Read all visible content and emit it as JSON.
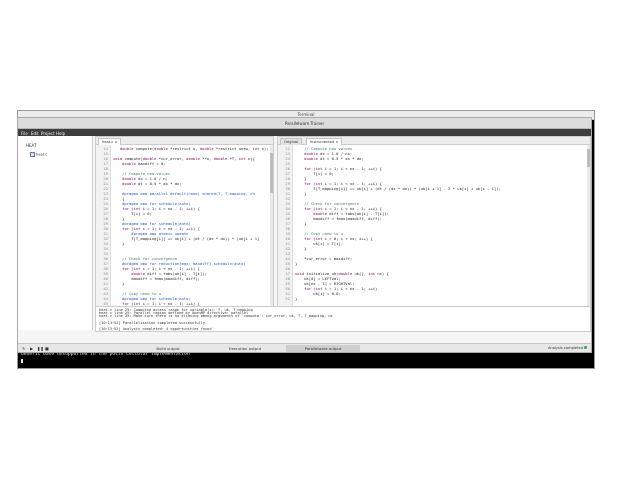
{
  "terminal": {
    "title": "Terminal",
    "line": "Generic base unsupported in the posix cellular implementation"
  },
  "ide": {
    "title": "Parallelware Trainer",
    "menu": [
      "File",
      "Edit",
      "Project",
      "Help"
    ]
  },
  "tree": {
    "root": "HEAT",
    "file": "heat.c"
  },
  "left_editor": {
    "tab": "heat.c",
    "first_line": 14,
    "lines": [
      "   double compute(double *restrict u, double *restrict unew, int n);",
      "",
      "void compute(double *cur_error, double **u, double *T, int n){",
      "    double maxdiff = 0;",
      "",
      "    // Compute new values",
      "    double dx = 1.0 / n;",
      "    double dt = 0.5 * dx * dx;",
      "",
      "    #pragma omp parallel default(none) shared(T, T_mapping, ch",
      "    {",
      "    #pragma omp for schedule(auto)",
      "    for (int i = 1; i < nx - 1; ++i) {",
      "        T[i] = 0;",
      "    }",
      "    #pragma omp for schedule(auto)",
      "    for (int i = 1; i < nx - 1; ++i) {",
      "        #pragma omp atomic update",
      "        T[T_mapping[i]] += uk[i] + (dt / (dx * dx)) * (uk[i + 1]",
      "    }",
      "",
      "",
      "    // Check for convergence",
      "    #pragma omp for reduction(max: maxdiff) schedule(auto)",
      "    for (int i = 1; i < nx - 1; ++i) {",
      "        double diff = fabs(uk[i] - T[i]);",
      "        maxdiff = fmax(maxdiff, diff);",
      "    }",
      "",
      "    // Copy unew to u",
      "    #pragma omp for schedule(auto)",
      "    for (int i = 1; i < nx - 1; ++i) {"
    ]
  },
  "right_editor": {
    "tabs": [
      "Original",
      "Instrumented"
    ],
    "first_line": 22,
    "lines": [
      "    // Compute new values",
      "    double dx = 1.0 / nx;",
      "    double dt = 0.5 * dx * dx;",
      "",
      "    for (int i = 1; i < nx - 1; ++i) {",
      "        T[i] = 0;",
      "    }",
      "    for (int i = 1; i < nx - 1; ++i) {",
      "        T[T_mapping[i]] += uk[i] + (dt / (dx * dx)) * (uk[i + 1] - 2 * uk[i] + uk[i - 1]);",
      "    }",
      "",
      "    // Check for convergence",
      "    for (int i = 1; i < nx - 1; ++i) {",
      "        double diff = fabs(uk[i] - T[i]);",
      "        maxdiff = fmax(maxdiff, diff);",
      "    }",
      "",
      "    // Copy unew to u",
      "    for (int i = 0; i < nx; i++) {",
      "        uk[i] = T[i];",
      "    }",
      "",
      "    *cur_error = maxdiff;",
      "}",
      "",
      "void initialize_uk(double uk[], int nx) {",
      "    uk[0] = LEFTVal;",
      "    uk[nx - 1] = RIGHTVal;",
      "    for (int i = 1; i < nx - 1; ++i)",
      "        uk[i] = 0.0;",
      "}"
    ]
  },
  "output": {
    "lines": [
      "heat.c line 29: Computed access range for variable(s): T, uk, T_mapping",
      "heat.c line 29: Parallel region defined by OpenMP directive: parallel",
      "heat.c line 29: Make sure there is no aliasing among arguments of 'compute': cur_error, uk, T, T_mapping, nx",
      "",
      "[10:13:52] Parallelization completed successfully.",
      "",
      "[10:13:52] Analysis completed: 4 opportunities found"
    ]
  },
  "bottombar": {
    "tabs": [
      "Build output",
      "Execution output",
      "Parallelware output"
    ],
    "active_tab": 2,
    "status": "Analysis completed"
  }
}
